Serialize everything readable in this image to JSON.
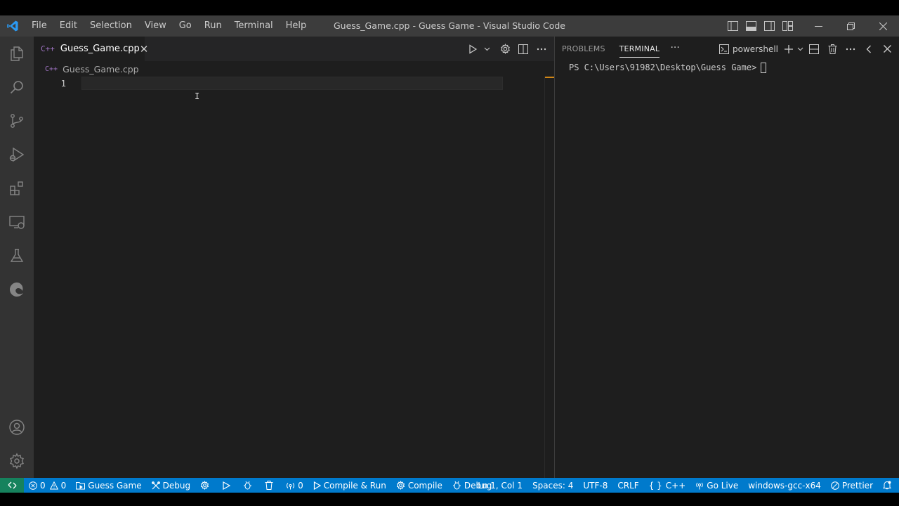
{
  "window": {
    "title": "Guess_Game.cpp - Guess Game - Visual Studio Code",
    "accent": "#007acc"
  },
  "menu": [
    "File",
    "Edit",
    "Selection",
    "View",
    "Go",
    "Run",
    "Terminal",
    "Help"
  ],
  "activity_bar": {
    "items": [
      "explorer-icon",
      "search-icon",
      "source-control-icon",
      "run-debug-icon",
      "extensions-icon",
      "remote-explorer-icon",
      "testing-icon",
      "edge-icon"
    ],
    "bottom": [
      "accounts-icon",
      "manage-gear-icon"
    ]
  },
  "editor": {
    "tab": {
      "icon_text": "C++",
      "label": "Guess_Game.cpp",
      "close": "✕"
    },
    "breadcrumb": {
      "icon_text": "C++",
      "label": "Guess_Game.cpp"
    },
    "line_number": "1",
    "cursor_glyph": "I"
  },
  "panel": {
    "tabs": [
      "PROBLEMS",
      "TERMINAL"
    ],
    "active_tab": "TERMINAL",
    "more": "···",
    "shell": "powershell",
    "prompt": "PS C:\\Users\\91982\\Desktop\\Guess Game>"
  },
  "statusbar": {
    "errors": "0",
    "warnings": "0",
    "folder": "Guess Game",
    "debug_label": "Debug",
    "ports": "0",
    "compile_run": "Compile & Run",
    "compile": "Compile",
    "debug2": "Debug",
    "position": "Ln 1, Col 1",
    "spaces": "Spaces: 4",
    "encoding": "UTF-8",
    "eol": "CRLF",
    "language": "C++",
    "language_prefix": "{ }",
    "go_live": "Go Live",
    "config": "windows-gcc-x64",
    "prettier": "Prettier"
  }
}
